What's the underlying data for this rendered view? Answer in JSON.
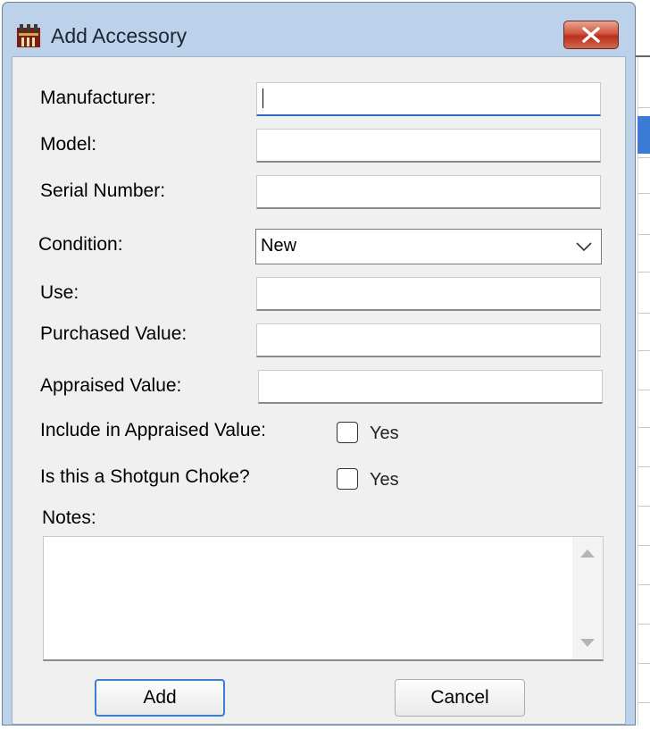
{
  "window": {
    "title": "Add Accessory"
  },
  "form": {
    "manufacturer": {
      "label": "Manufacturer:",
      "value": ""
    },
    "model": {
      "label": "Model:",
      "value": ""
    },
    "serial_number": {
      "label": "Serial Number:",
      "value": ""
    },
    "condition": {
      "label": "Condition:",
      "selected": "New"
    },
    "use": {
      "label": "Use:",
      "value": ""
    },
    "purchased_value": {
      "label": "Purchased Value:",
      "value": ""
    },
    "appraised_value": {
      "label": "Appraised Value:",
      "value": ""
    },
    "include_in_appraised": {
      "label": "Include in Appraised Value:",
      "option_label": "Yes",
      "checked": false
    },
    "shotgun_choke": {
      "label": "Is this a Shotgun Choke?",
      "option_label": "Yes",
      "checked": false
    },
    "notes": {
      "label": "Notes:",
      "value": ""
    }
  },
  "buttons": {
    "add": "Add",
    "cancel": "Cancel"
  },
  "icons": {
    "app": "app-icon",
    "close": "close-icon",
    "dropdown": "chevron-down-icon",
    "scroll_up": "scroll-up-arrow-icon",
    "scroll_down": "scroll-down-arrow-icon"
  },
  "colors": {
    "title_bar": "#bcd2ea",
    "client_bg": "#f0f0f0",
    "close_button": "#c8442e",
    "focus_accent": "#2a6ac3",
    "default_button_border": "#3c7fcf"
  }
}
